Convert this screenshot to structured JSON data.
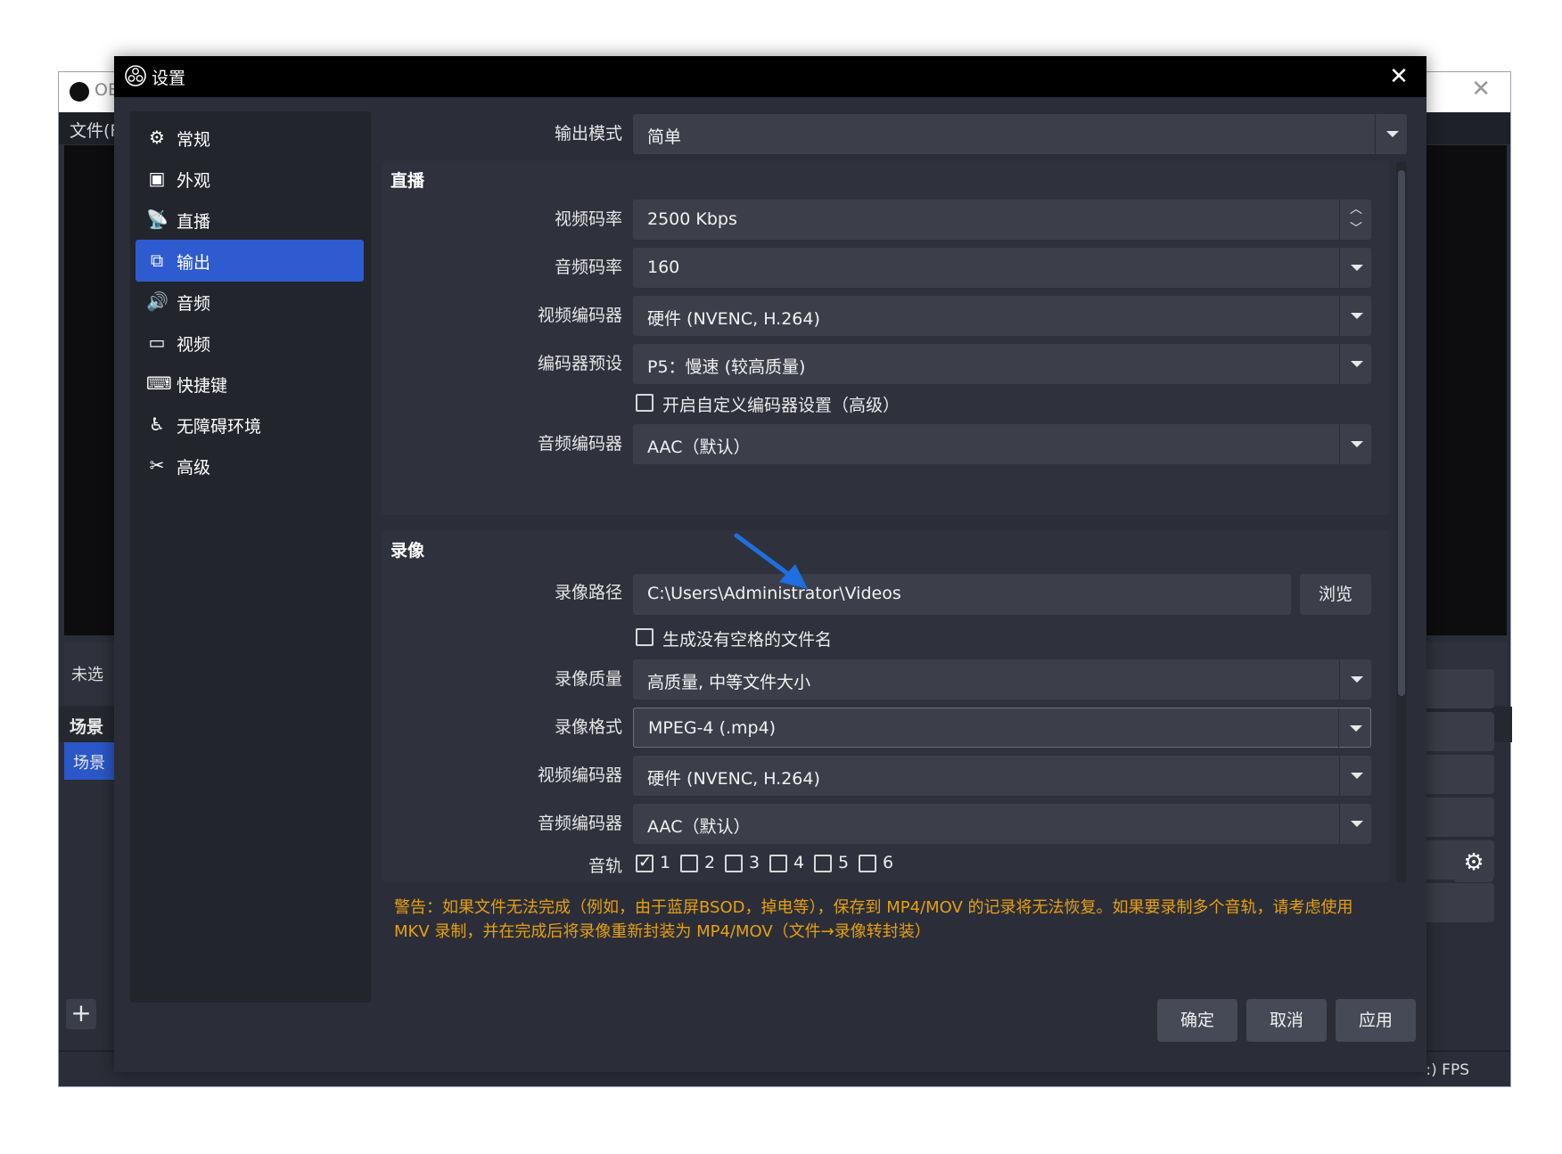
{
  "main_window": {
    "title": "OB",
    "menu_file": "文件(F",
    "no_source": "未选",
    "scenes_header": "场景",
    "scene_item": "场景",
    "add_button": "+",
    "fps": ":) FPS"
  },
  "dialog": {
    "title": "设置",
    "close": "✕"
  },
  "sidebar": {
    "items": [
      {
        "label": "常规",
        "icon": "gear-icon"
      },
      {
        "label": "外观",
        "icon": "appearance-icon"
      },
      {
        "label": "直播",
        "icon": "broadcast-icon"
      },
      {
        "label": "输出",
        "icon": "output-icon"
      },
      {
        "label": "音频",
        "icon": "speaker-icon"
      },
      {
        "label": "视频",
        "icon": "monitor-icon"
      },
      {
        "label": "快捷键",
        "icon": "keyboard-icon"
      },
      {
        "label": "无障碍环境",
        "icon": "accessibility-icon"
      },
      {
        "label": "高级",
        "icon": "tools-icon"
      }
    ],
    "active": "输出"
  },
  "output_mode": {
    "label": "输出模式",
    "value": "简单"
  },
  "streaming": {
    "title": "直播",
    "video_bitrate": {
      "label": "视频码率",
      "value": "2500 Kbps"
    },
    "audio_bitrate": {
      "label": "音频码率",
      "value": "160"
    },
    "video_encoder": {
      "label": "视频编码器",
      "value": "硬件 (NVENC, H.264)"
    },
    "encoder_preset": {
      "label": "编码器预设",
      "value": "P5：慢速 (较高质量)"
    },
    "custom_encoder": {
      "label": "开启自定义编码器设置（高级）",
      "checked": false
    },
    "audio_encoder": {
      "label": "音频编码器",
      "value": "AAC（默认）"
    }
  },
  "recording": {
    "title": "录像",
    "path": {
      "label": "录像路径",
      "value": "C:\\Users\\Administrator\\Videos"
    },
    "browse": "浏览",
    "no_space": {
      "label": "生成没有空格的文件名",
      "checked": false
    },
    "quality": {
      "label": "录像质量",
      "value": "高质量, 中等文件大小"
    },
    "format": {
      "label": "录像格式",
      "value": "MPEG-4 (.mp4)"
    },
    "video_encoder": {
      "label": "视频编码器",
      "value": "硬件 (NVENC, H.264)"
    },
    "audio_encoder": {
      "label": "音频编码器",
      "value": "AAC（默认）"
    },
    "tracks_label": "音轨",
    "tracks": [
      {
        "label": "1",
        "checked": true
      },
      {
        "label": "2",
        "checked": false
      },
      {
        "label": "3",
        "checked": false
      },
      {
        "label": "4",
        "checked": false
      },
      {
        "label": "5",
        "checked": false
      },
      {
        "label": "6",
        "checked": false
      }
    ]
  },
  "warning": "警告：如果文件无法完成（例如，由于蓝屏BSOD，掉电等），保存到 MP4/MOV 的记录将无法恢复。如果要录制多个音轨，请考虑使用 MKV 录制，并在完成后将录像重新封装为 MP4/MOV（文件→录像转封装）",
  "buttons": {
    "ok": "确定",
    "cancel": "取消",
    "apply": "应用"
  },
  "colors": {
    "accent": "#2f5bd0",
    "warning": "#e6a012",
    "annotation_arrow": "#1e6fe0"
  }
}
